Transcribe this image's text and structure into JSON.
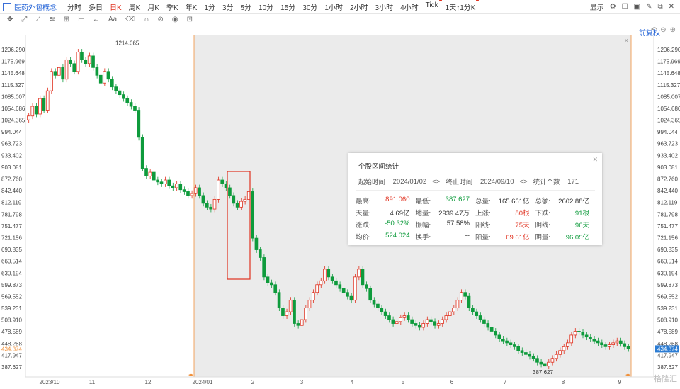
{
  "header": {
    "title": "医药外包概念",
    "periods": [
      "分时",
      "多日",
      "日K",
      "周K",
      "月K",
      "季K",
      "年K",
      "1分",
      "3分",
      "5分",
      "10分",
      "15分",
      "30分",
      "1小时",
      "2小时",
      "3小时",
      "4小时",
      "Tick",
      "1天↑1分K"
    ],
    "active_period": "日K",
    "display_label": "显示"
  },
  "chart": {
    "adjust_label": "前复权",
    "price_labels": [
      "1206.290",
      "1175.969",
      "1145.648",
      "1115.327",
      "1085.007",
      "1054.686",
      "1024.365",
      "994.044",
      "963.723",
      "933.402",
      "903.081",
      "872.760",
      "842.440",
      "812.119",
      "781.798",
      "751.477",
      "721.156",
      "690.835",
      "660.514",
      "630.194",
      "599.873",
      "569.552",
      "539.231",
      "508.910",
      "478.589",
      "448.268",
      "417.947",
      "387.627"
    ],
    "current_price": "434.374",
    "high_label": "1214.065",
    "low_label": "387.627",
    "x_labels": [
      "2023/10",
      "11",
      "12",
      "2024/01",
      "2",
      "3",
      "4",
      "5",
      "6",
      "7",
      "8",
      "9"
    ],
    "accent": "#f0903a",
    "up_color": "#e0311f",
    "down_color": "#0e9b3c"
  },
  "panel": {
    "title": "个股区间统计",
    "start_label": "起始时间:",
    "start_value": "2024/01/02",
    "end_label": "终止时间:",
    "end_value": "2024/09/10",
    "count_label": "统计个数:",
    "count_value": "171",
    "rows": [
      [
        [
          "最高:",
          "891.060",
          "red"
        ],
        [
          "最低:",
          "387.627",
          "green"
        ],
        [
          "总量:",
          "165.661亿",
          "blk"
        ],
        [
          "总额:",
          "2602.88亿",
          "blk"
        ]
      ],
      [
        [
          "天量:",
          "4.69亿",
          "blk"
        ],
        [
          "地量:",
          "2939.47万",
          "blk"
        ],
        [
          "上涨:",
          "80根",
          "red"
        ],
        [
          "下跌:",
          "91根",
          "green"
        ]
      ],
      [
        [
          "涨跌:",
          "-50.32%",
          "green"
        ],
        [
          "振幅:",
          "57.58%",
          "blk"
        ],
        [
          "阳线:",
          "75天",
          "red"
        ],
        [
          "阴线:",
          "96天",
          "green"
        ]
      ],
      [
        [
          "均价:",
          "524.024",
          "green"
        ],
        [
          "换手:",
          "--",
          "blk"
        ],
        [
          "阳量:",
          "69.61亿",
          "red"
        ],
        [
          "阴量:",
          "96.05亿",
          "green"
        ]
      ]
    ]
  },
  "watermark": "格隆汇"
}
